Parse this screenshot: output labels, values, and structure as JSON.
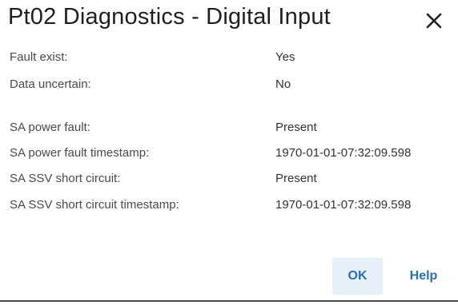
{
  "dialog": {
    "title": "Pt02 Diagnostics - Digital Input"
  },
  "status": [
    {
      "label": "Fault exist:",
      "value": "Yes"
    },
    {
      "label": "Data uncertain:",
      "value": "No"
    }
  ],
  "details": [
    {
      "label": "SA power fault:",
      "value": "Present"
    },
    {
      "label": "SA power fault timestamp:",
      "value": "1970-01-01-07:32:09.598"
    },
    {
      "label": "SA SSV short circuit:",
      "value": "Present"
    },
    {
      "label": "SA SSV short circuit timestamp:",
      "value": "1970-01-01-07:32:09.598"
    }
  ],
  "buttons": {
    "ok_label": "OK",
    "help_label": "Help"
  },
  "icons": {
    "close": "close-icon"
  },
  "colors": {
    "accent": "#2a6fb5",
    "ok_background": "#e6f0f9",
    "label_text": "#4a4a4a"
  }
}
